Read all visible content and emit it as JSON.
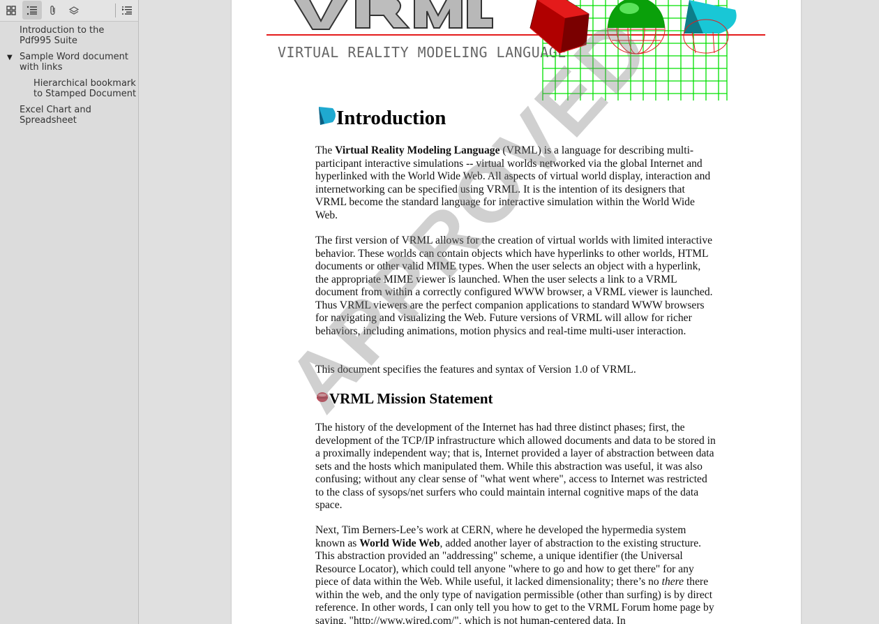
{
  "toolbar": {
    "buttons": [
      {
        "icon": "thumbnails-icon",
        "active": false
      },
      {
        "icon": "outline-icon",
        "active": true
      },
      {
        "icon": "attachments-icon",
        "active": false
      },
      {
        "icon": "layers-icon",
        "active": false
      },
      {
        "icon": "current-outline-item-icon",
        "active": false
      }
    ]
  },
  "outline": {
    "items": [
      {
        "label": "Introduction to the Pdf995 Suite"
      },
      {
        "label": "Sample Word document with links",
        "toggle": "▼"
      },
      {
        "label": "Hierarchical bookmark to Stamped Document"
      },
      {
        "label": "Excel Chart and Spreadsheet"
      }
    ]
  },
  "document": {
    "banner_subtitle": "VIRTUAL REALITY MODELING LANGUAGE",
    "intro_heading": "Introduction",
    "intro_p1_a": "The ",
    "intro_p1_bold": "Virtual Reality Modeling Language",
    "intro_p1_b": " (VRML) is a language for describing multi-participant interactive simulations -- virtual worlds networked via the global Internet and hyperlinked with the World Wide Web. All aspects of virtual world display, interaction and internetworking can be specified using VRML. It is the intention of its designers that VRML become the standard language for interactive simulation within the World Wide Web.",
    "intro_p2": "The first version of VRML allows for the creation of virtual worlds with limited interactive behavior. These worlds can contain objects which have hyperlinks to other worlds, HTML documents or other valid MIME types. When the user selects an object with a hyperlink, the appropriate MIME viewer is launched. When the user selects a link to a VRML document from within a correctly configured WWW browser, a VRML viewer is launched. Thus VRML viewers are the perfect companion applications to standard WWW browsers for navigating and visualizing the Web. Future versions of VRML will allow for richer behaviors, including animations, motion physics and real-time multi-user interaction.",
    "intro_p3": "This document specifies the features and syntax of Version 1.0 of VRML.",
    "mission_heading": "VRML Mission Statement",
    "mission_p1": "The history of the development of the Internet has had three distinct phases; first, the development of the TCP/IP infrastructure which allowed documents and data to be stored in a proximally independent way; that is, Internet provided a layer of abstraction between data sets and the hosts which manipulated them. While this abstraction was useful, it was also confusing; without any clear sense of \"what went where\", access to Internet was restricted to the class of sysops/net surfers who could maintain internal cognitive maps of the data space.",
    "mission_p2_a": "Next, Tim Berners-Lee’s work at CERN, where he developed the hypermedia system known as ",
    "mission_p2_bold": "World Wide Web",
    "mission_p2_b": ", added another layer of abstraction to the existing structure. This abstraction provided an \"addressing\" scheme, a unique identifier (the Universal Resource Locator), which could tell anyone \"where to go and how to get there\" for any piece of data within the Web. While useful, it lacked dimensionality; there’s no ",
    "mission_p2_italic": "there",
    "mission_p2_c": " there within the web, and the only type of navigation permissible (other than surfing) is by direct reference. In other words, I can only tell you how to get to the VRML Forum home page by saying, \"http://www.wired.com/\", which is not human-centered data. In",
    "watermark": "APPROVED"
  },
  "colors": {
    "banner_red": "#e41b1b",
    "grid_green": "#00e000",
    "sphere_green": "#0aa00a",
    "cube_red": "#c00000",
    "cone_cyan": "#19c7d6"
  }
}
